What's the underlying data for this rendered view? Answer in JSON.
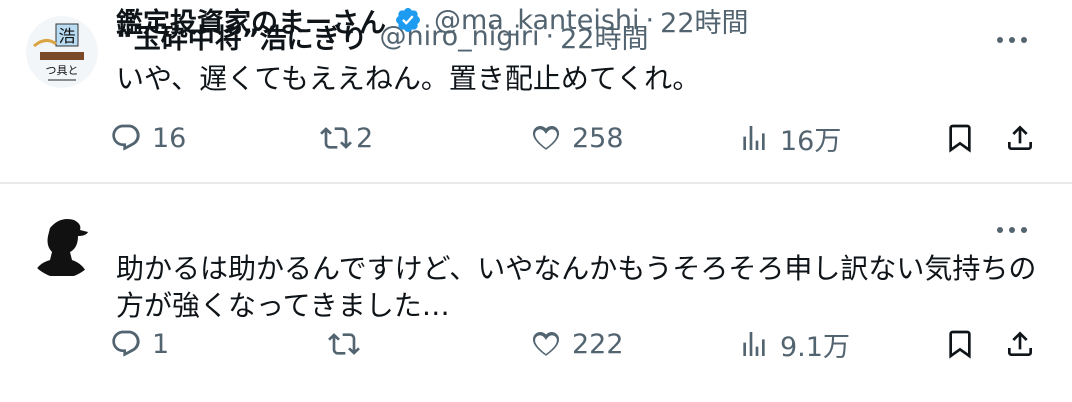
{
  "tweets": [
    {
      "name": "“玉砕中将”浩にぎり",
      "handle": "@hiro_nigiri",
      "separator": "·",
      "time": "22時間",
      "text": "いや、遅くてもええねん。置き配止めてくれ。",
      "avatar_text": [
        "浩",
        "つ具と"
      ],
      "verified": false,
      "stats": {
        "replies": "16",
        "reposts": "2",
        "likes": "258",
        "views": "16万"
      }
    },
    {
      "name": "鑑定投資家のまーさん",
      "handle": "@ma_kanteishi",
      "separator": "·",
      "time": "22時間",
      "text": "助かるは助かるんですけど、いやなんかもうそろそろ申し訳ない気持ちの方が強くなってきました…",
      "verified": true,
      "stats": {
        "replies": "1",
        "reposts": "",
        "likes": "222",
        "views": "9.1万"
      }
    }
  ],
  "colors": {
    "text": "#0f1419",
    "muted": "#536471",
    "verified": "#1d9bf0",
    "divider": "#e7e9ea"
  },
  "icons": [
    "reply-icon",
    "repost-icon",
    "like-icon",
    "views-icon",
    "bookmark-icon",
    "share-icon",
    "more-icon",
    "verified-icon"
  ]
}
